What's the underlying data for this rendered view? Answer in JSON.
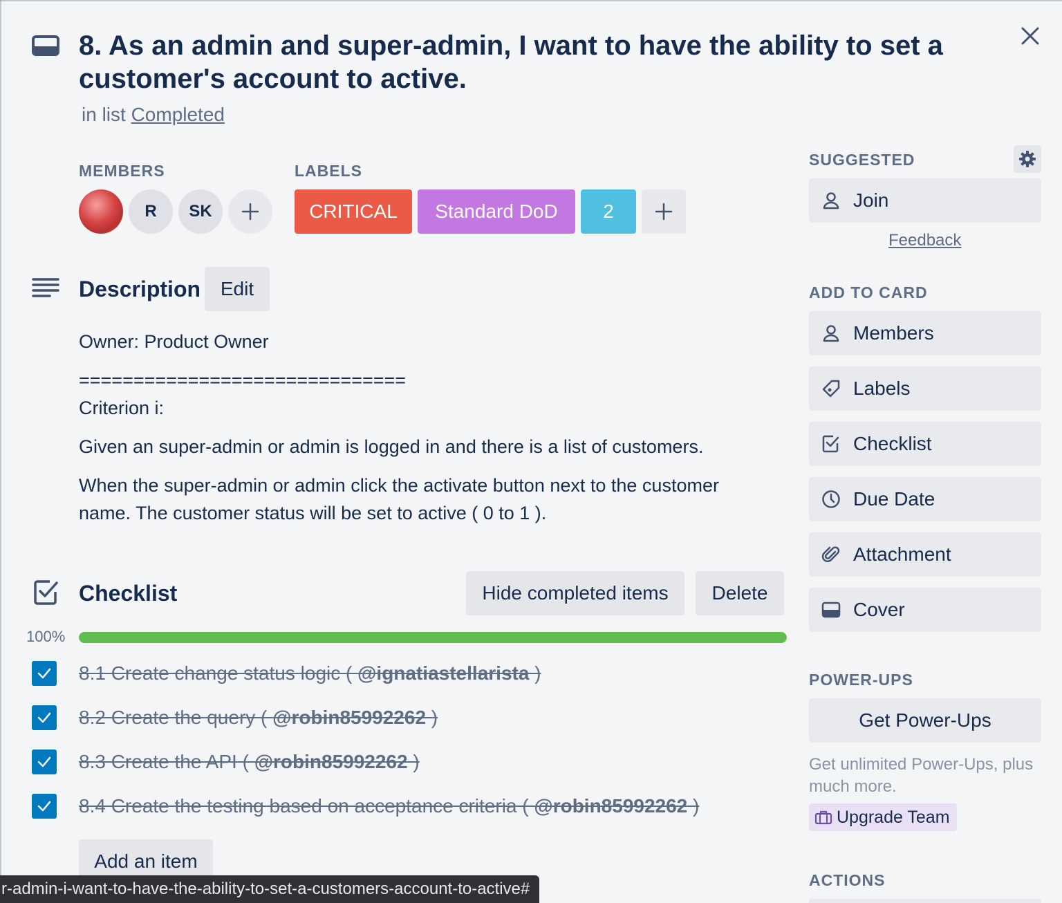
{
  "card": {
    "title": "8. As an admin and super-admin, I want to have the ability to set a customer's account to active.",
    "in_list_prefix": "in list",
    "list_name": "Completed"
  },
  "members": {
    "heading": "MEMBERS",
    "items": [
      {
        "initials": "",
        "kind": "photo"
      },
      {
        "initials": "R"
      },
      {
        "initials": "SK"
      }
    ]
  },
  "labels": {
    "heading": "LABELS",
    "items": [
      {
        "text": "CRITICAL",
        "color": "#eb5a46"
      },
      {
        "text": "Standard DoD",
        "color": "#c377e0"
      },
      {
        "text": "2",
        "color": "#4fc0e0"
      }
    ]
  },
  "description": {
    "heading": "Description",
    "edit_label": "Edit",
    "lines": [
      "Owner: Product Owner",
      "==============================",
      "Criterion i:",
      "Given an super-admin or admin is logged in and there is a list of customers.",
      "When the super-admin or admin click the activate button next to the customer",
      "name. The customer status will be set to active ( 0 to 1 )."
    ]
  },
  "checklist": {
    "heading": "Checklist",
    "hide_label": "Hide completed items",
    "delete_label": "Delete",
    "percent_text": "100%",
    "progress": 1.0,
    "progress_color": "#61bd4f",
    "items": [
      {
        "text": "8.1 Create change status logic ( ",
        "mention": "@ignatiastellarista",
        "suffix": " )",
        "checked": true
      },
      {
        "text": "8.2 Create the query ( ",
        "mention": "@robin85992262",
        "suffix": " )",
        "checked": true
      },
      {
        "text": "8.3 Create the API ( ",
        "mention": "@robin85992262",
        "suffix": " )",
        "checked": true
      },
      {
        "text": "8.4 Create the testing based on acceptance criteria ( ",
        "mention": "@robin85992262",
        "suffix": " )",
        "checked": true
      }
    ],
    "add_item_label": "Add an item"
  },
  "sidebar": {
    "suggested_heading": "SUGGESTED",
    "join_label": "Join",
    "feedback_label": "Feedback",
    "add_to_card_heading": "ADD TO CARD",
    "add_items": [
      {
        "label": "Members",
        "icon": "person-icon"
      },
      {
        "label": "Labels",
        "icon": "tag-icon"
      },
      {
        "label": "Checklist",
        "icon": "checklist-icon"
      },
      {
        "label": "Due Date",
        "icon": "clock-icon"
      },
      {
        "label": "Attachment",
        "icon": "paperclip-icon"
      },
      {
        "label": "Cover",
        "icon": "cover-icon"
      }
    ],
    "powerups_heading": "POWER-UPS",
    "get_powerups_label": "Get Power-Ups",
    "powerups_desc": "Get unlimited Power-Ups, plus much more.",
    "upgrade_label": "Upgrade Team",
    "actions_heading": "ACTIONS"
  },
  "status_bar": {
    "url": "r-admin-i-want-to-have-the-ability-to-set-a-customers-account-to-active#"
  }
}
